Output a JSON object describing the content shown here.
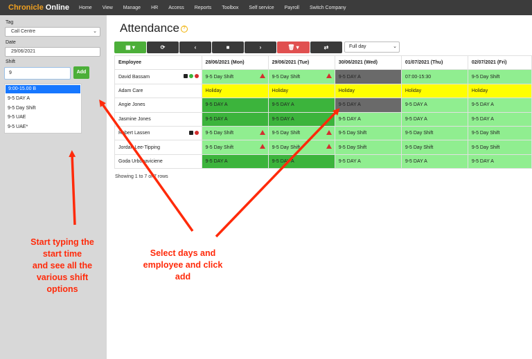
{
  "app": {
    "brand_part1": "Chronicle",
    "brand_part2": "Online"
  },
  "nav": [
    "Home",
    "View",
    "Manage",
    "HR",
    "Access",
    "Reports",
    "Toolbox",
    "Self service",
    "Payroll",
    "Switch Company"
  ],
  "sidebar": {
    "tag_label": "Tag",
    "tag_value": "Call Centre",
    "date_label": "Date",
    "date_value": "29/06/2021",
    "shift_label": "Shift",
    "shift_value": "9",
    "add_label": "Add",
    "shift_options": [
      "9:00-15.00 B",
      "9-5 DAY A",
      "9-5 Day Shift",
      "9-5 UAE",
      "9-5 UAE*"
    ]
  },
  "page": {
    "title": "Attendance",
    "help_icon_glyph": "?"
  },
  "toolbar": {
    "icons": [
      "calendar-menu-icon",
      "refresh-icon",
      "prev-icon",
      "stop-icon",
      "next-icon",
      "delete-menu-icon",
      "swap-icon"
    ],
    "glyphs": {
      "calendar": "▦ ▾",
      "refresh": "⟳",
      "prev": "‹",
      "stop": "■",
      "next": "›",
      "delete": "🗑 ▾",
      "swap": "⇄"
    },
    "range_value": "Full day"
  },
  "table": {
    "headers": [
      "Employee",
      "28/06/2021 (Mon)",
      "29/06/2021 (Tue)",
      "30/06/2021 (Wed)",
      "01/07/2021 (Thu)",
      "02/07/2021 (Fri)"
    ],
    "rows": [
      {
        "name": "David Bassam",
        "cells": [
          "9-5 Day Shift",
          "9-5 Day Shift",
          "9-5 DAY A",
          "07:00-15:30",
          "9-5 Day Shift"
        ]
      },
      {
        "name": "Adam Care",
        "cells": [
          "Holiday",
          "Holiday",
          "Holiday",
          "Holiday",
          "Holiday"
        ]
      },
      {
        "name": "Angie Jones",
        "cells": [
          "9-5 DAY A",
          "9-5 DAY A",
          "9-5 DAY A",
          "9-5 DAY A",
          "9-5 DAY A"
        ]
      },
      {
        "name": "Jasmine Jones",
        "cells": [
          "9-5 DAY A",
          "9-5 DAY A",
          "9-5 DAY A",
          "9-5 DAY A",
          "9-5 DAY A"
        ]
      },
      {
        "name": "Robert Lassen",
        "cells": [
          "9-5 Day Shift",
          "9-5 Day Shift",
          "9-5 Day Shift",
          "9-5 Day Shift",
          "9-5 Day Shift"
        ]
      },
      {
        "name": "Jordan Lee-Tipping",
        "cells": [
          "9-5 Day Shift",
          "9-5 Day Shift",
          "9-5 Day Shift",
          "9-5 Day Shift",
          "9-5 Day Shift"
        ]
      },
      {
        "name": "Goda Urbonaviciene",
        "cells": [
          "9-5 DAY A",
          "9-5 DAY A",
          "9-5 DAY A",
          "9-5 DAY A",
          "9-5 DAY A"
        ]
      }
    ],
    "footer": "Showing 1 to 7 of 7 rows"
  },
  "colors": {
    "light_green": "#90ee90",
    "dark_green": "#3cb43c",
    "yellow": "#ffff00",
    "grey": "#6a6a6a",
    "annotation_red": "#ff2a0a"
  },
  "annotations": {
    "left": [
      "Start typing the",
      "start time",
      "and see all the",
      "various shift",
      "options"
    ],
    "center": [
      "Select days and",
      "employee and click",
      "add"
    ]
  }
}
